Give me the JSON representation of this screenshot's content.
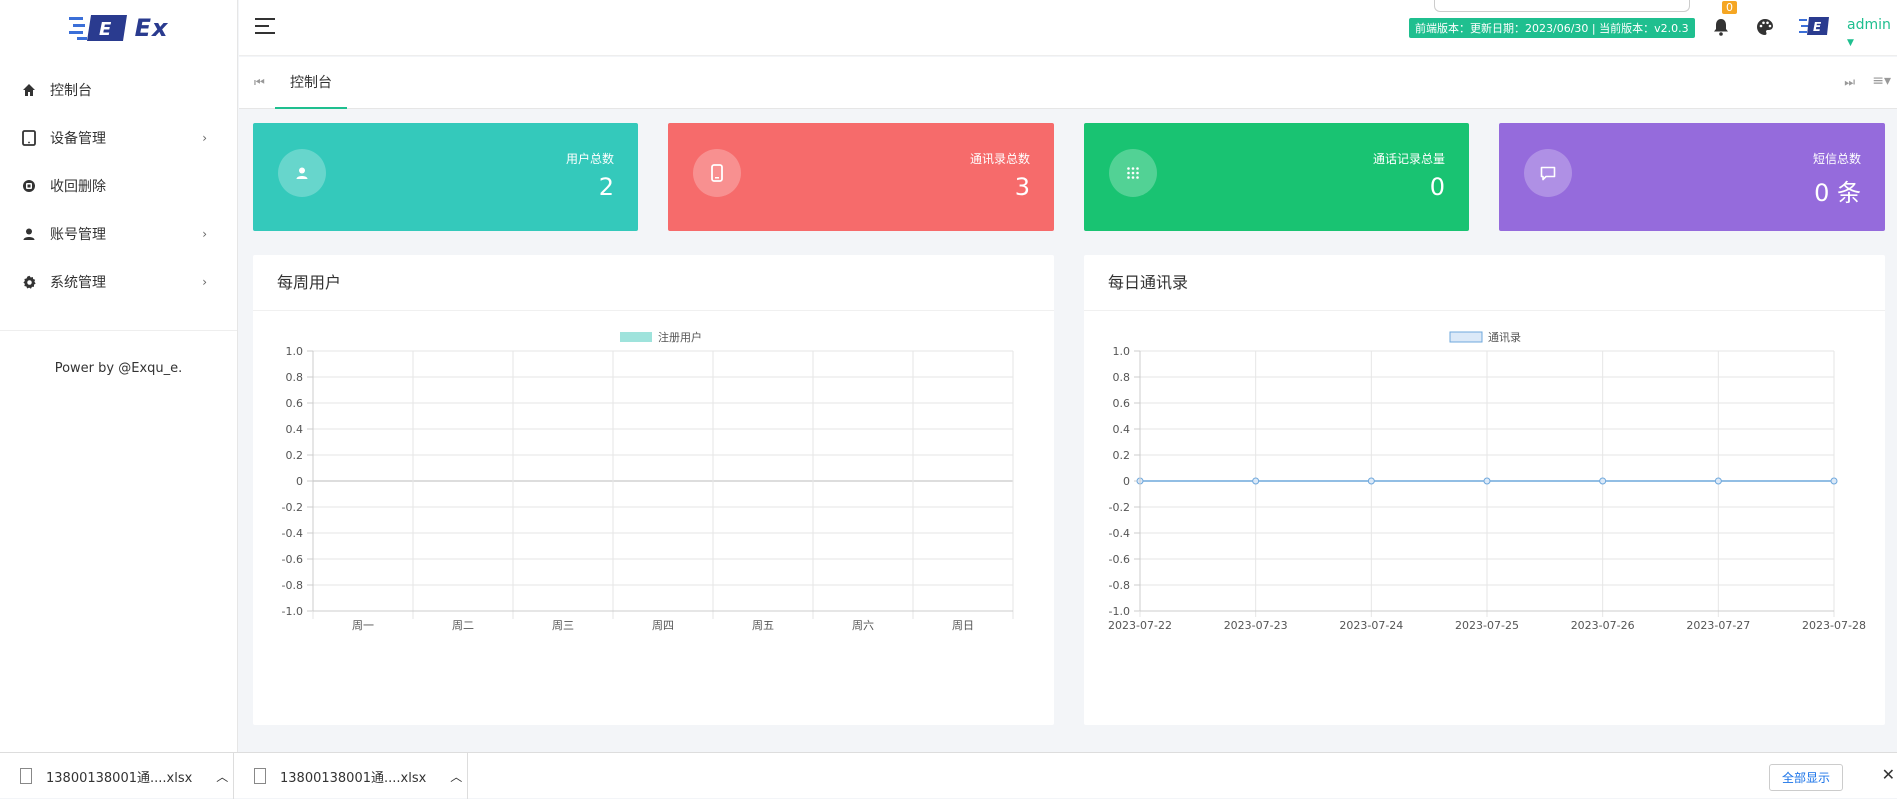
{
  "app": {
    "logo_text": "Ex"
  },
  "sidebar": {
    "items": [
      {
        "label": "控制台",
        "icon": "home-icon",
        "has_arrow": false
      },
      {
        "label": "设备管理",
        "icon": "tablet-icon",
        "has_arrow": true
      },
      {
        "label": "收回删除",
        "icon": "recycle-icon",
        "has_arrow": false
      },
      {
        "label": "账号管理",
        "icon": "user-icon",
        "has_arrow": true
      },
      {
        "label": "系统管理",
        "icon": "gear-icon",
        "has_arrow": true
      }
    ],
    "power": "Power by @Exqu_e."
  },
  "header": {
    "version_text": "前端版本：更新日期：2023/06/30 | 当前版本：v2.0.3",
    "notif_count": "0",
    "user": "admin"
  },
  "tabs": {
    "active": "控制台"
  },
  "cards": [
    {
      "label": "用户总数",
      "value": "2",
      "color": "#34c9bb",
      "icon": "user-icon"
    },
    {
      "label": "通讯录总数",
      "value": "3",
      "color": "#f66b6b",
      "icon": "phone-icon"
    },
    {
      "label": "通话记录总量",
      "value": "0",
      "color": "#19c372",
      "icon": "dialpad-icon"
    },
    {
      "label": "短信总数",
      "value": "0 条",
      "color": "#956bdc",
      "icon": "message-icon"
    }
  ],
  "panels": {
    "weekly_title": "每周用户",
    "daily_title": "每日通讯录"
  },
  "chart_data": [
    {
      "type": "bar",
      "title": "",
      "categories": [
        "周一",
        "周二",
        "周三",
        "周四",
        "周五",
        "周六",
        "周日"
      ],
      "series": [
        {
          "name": "注册用户",
          "values": [
            0,
            0,
            0,
            0,
            0,
            0,
            0
          ],
          "color": "#9fe3dc"
        }
      ],
      "ylim": [
        -1.0,
        1.0
      ],
      "yticks": [
        "1.0",
        "0.8",
        "0.6",
        "0.4",
        "0.2",
        "0",
        "-0.2",
        "-0.4",
        "-0.6",
        "-0.8",
        "-1.0"
      ],
      "grid": true,
      "legend": "top-center"
    },
    {
      "type": "line",
      "title": "",
      "categories": [
        "2023-07-22",
        "2023-07-23",
        "2023-07-24",
        "2023-07-25",
        "2023-07-26",
        "2023-07-27",
        "2023-07-28"
      ],
      "series": [
        {
          "name": "通讯录",
          "values": [
            0,
            0,
            0,
            0,
            0,
            0,
            0
          ],
          "color": "#6fa8dc"
        }
      ],
      "ylim": [
        -1.0,
        1.0
      ],
      "yticks": [
        "1.0",
        "0.8",
        "0.6",
        "0.4",
        "0.2",
        "0",
        "-0.2",
        "-0.4",
        "-0.6",
        "-0.8",
        "-1.0"
      ],
      "grid": true,
      "legend": "top-center"
    }
  ],
  "downloads": [
    {
      "name": "13800138001通....xlsx"
    },
    {
      "name": "13800138001通....xlsx"
    }
  ],
  "download_bar": {
    "show_all": "全部显示"
  }
}
